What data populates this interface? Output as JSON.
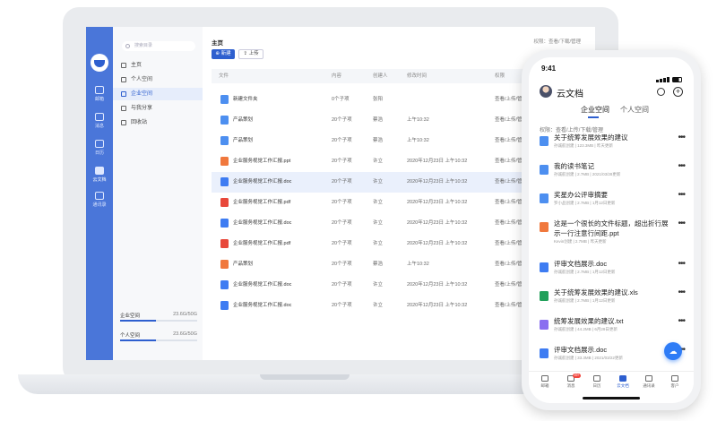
{
  "colors": {
    "accent": "#2e5fcf",
    "rail": "#4a76d9",
    "folder": "#4d8ff0",
    "ppt": "#f0783d",
    "word": "#3e7cf2",
    "pdf": "#e8483b",
    "xls": "#21a05a",
    "txt": "#8a6ff0"
  },
  "desktop": {
    "rail": [
      {
        "label": "邮箱",
        "icon": "mail-icon"
      },
      {
        "label": "消息",
        "icon": "chat-icon"
      },
      {
        "label": "日历",
        "icon": "calendar-icon"
      },
      {
        "label": "云文档",
        "icon": "folder-icon"
      },
      {
        "label": "通讯录",
        "icon": "contacts-icon"
      }
    ],
    "search_placeholder": "搜索目录",
    "nav": [
      {
        "label": "主页",
        "icon": "home-icon"
      },
      {
        "label": "个人空间",
        "icon": "user-icon"
      },
      {
        "label": "企业空间",
        "icon": "building-icon"
      },
      {
        "label": "与我分享",
        "icon": "share-icon"
      },
      {
        "label": "回收站",
        "icon": "trash-icon"
      }
    ],
    "quota": [
      {
        "label": "企业空间",
        "value": "23.6G/50G",
        "fraction": 0.47
      },
      {
        "label": "个人空间",
        "value": "23.6G/50G",
        "fraction": 0.47
      }
    ],
    "page_title": "主页",
    "permission": "权限：查看/下载/管理",
    "new_button": "新建",
    "upload_button": "上传",
    "columns": [
      "文件",
      "内容",
      "创建人",
      "修改时间",
      "权限"
    ],
    "files": [
      {
        "name": "新建文件夹",
        "type": "folder",
        "content": "0个子项",
        "creator": "张阳",
        "modified": "",
        "perm": "查看/上传/管理"
      },
      {
        "name": "产品策划",
        "type": "folder",
        "content": "20个子项",
        "creator": "蔡浩",
        "modified": "上午10:32",
        "perm": "查看/上传/管理"
      },
      {
        "name": "产品策划",
        "type": "folder",
        "content": "20个子项",
        "creator": "蔡浩",
        "modified": "上午10:32",
        "perm": "查看/上传/管理"
      },
      {
        "name": "企业服务视觉工作汇报.ppt",
        "type": "ppt",
        "content": "20个子项",
        "creator": "许立",
        "modified": "2020年12月23日 上午10:32",
        "perm": "查看/上传/管理"
      },
      {
        "name": "企业服务视觉工作汇报.doc",
        "type": "word",
        "content": "20个子项",
        "creator": "许立",
        "modified": "2020年12月23日 上午10:32",
        "perm": "查看/上传/管理"
      },
      {
        "name": "企业服务视觉工作汇报.pdf",
        "type": "pdf",
        "content": "20个子项",
        "creator": "许立",
        "modified": "2020年12月23日 上午10:32",
        "perm": "查看/上传/管理"
      },
      {
        "name": "企业服务视觉工作汇报.doc",
        "type": "word",
        "content": "20个子项",
        "creator": "许立",
        "modified": "2020年12月23日 上午10:32",
        "perm": "查看/上传/管理"
      },
      {
        "name": "企业服务视觉工作汇报.pdf",
        "type": "pdf",
        "content": "20个子项",
        "creator": "许立",
        "modified": "2020年12月23日 上午10:32",
        "perm": "查看/上传/管理"
      },
      {
        "name": "产品策划",
        "type": "ppt",
        "content": "20个子项",
        "creator": "蔡浩",
        "modified": "上午10:32",
        "perm": "查看/上传/管理"
      },
      {
        "name": "企业服务视觉工作汇报.doc",
        "type": "word",
        "content": "20个子项",
        "creator": "许立",
        "modified": "2020年12月23日 上午10:32",
        "perm": "查看/上传/管理"
      },
      {
        "name": "企业服务视觉工作汇报.doc",
        "type": "word",
        "content": "20个子项",
        "creator": "许立",
        "modified": "2020年12月23日 上午10:32",
        "perm": "查看/上传/管理"
      }
    ]
  },
  "mobile": {
    "time": "9:41",
    "title": "云文档",
    "tabs": [
      "企业空间",
      "个人空间"
    ],
    "permission": "权限：查看/上传/下载/管理",
    "items": [
      {
        "name": "关于统筹发展效果的建议",
        "meta": "孙诚航创建 | 123.3MB | 昨天更新",
        "type": "folder"
      },
      {
        "name": "我的读书笔记",
        "meta": "孙诚航创建 | 2.7MB | 2021/03/28更新",
        "type": "folder"
      },
      {
        "name": "奖星办公评审摘要",
        "meta": "罗小品创建 | 2.7MB | 1月12日更新",
        "type": "folder"
      },
      {
        "name": "这是一个很长的文件标题，超出折行展示一行注意行间距.ppt",
        "meta": "Kevin创建 | 2.7MB | 昨天更新",
        "type": "ppt"
      },
      {
        "name": "评审文档展示.doc",
        "meta": "孙诚航创建 | 2.7MB | 1月12日更新",
        "type": "word"
      },
      {
        "name": "关于统筹发展效果的建议.xls",
        "meta": "孙诚航创建 | 2.7MB | 1月12日更新",
        "type": "xls"
      },
      {
        "name": "统筹发展效果的建议.txt",
        "meta": "孙诚航创建 | 44.2MB | 6月29日更新",
        "type": "txt"
      },
      {
        "name": "评审文档展示.doc",
        "meta": "孙诚航创建 | 33.3MB | 2021/03/22更新",
        "type": "word"
      }
    ],
    "tabbar": [
      {
        "label": "邮箱",
        "icon": "mail-icon"
      },
      {
        "label": "消息",
        "icon": "chat-icon",
        "badge": "99+"
      },
      {
        "label": "日历",
        "icon": "calendar-icon"
      },
      {
        "label": "云文档",
        "icon": "folder-icon"
      },
      {
        "label": "通讯录",
        "icon": "contacts-icon"
      },
      {
        "label": "客户",
        "icon": "customer-icon"
      }
    ]
  }
}
